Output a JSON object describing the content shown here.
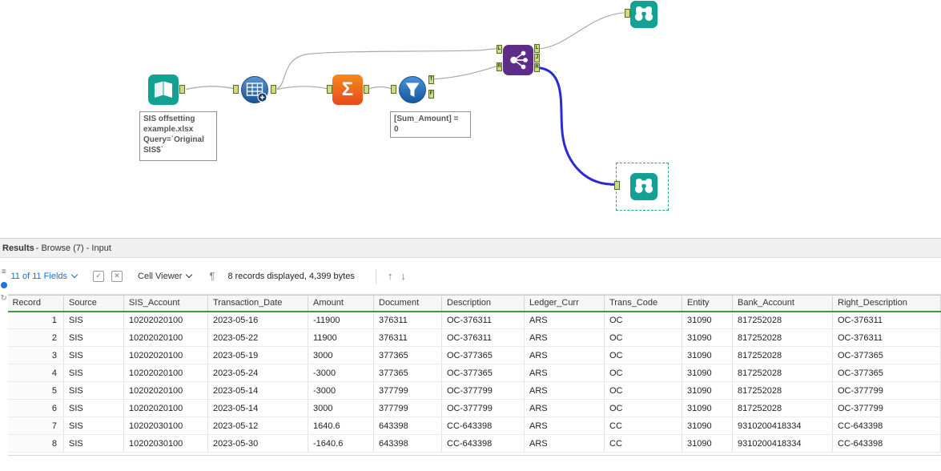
{
  "workflow": {
    "annotations": {
      "input": "SIS offsetting\nexample.xlsx\nQuery=`Original\nSIS$`",
      "filter": "[Sum_Amount] =\n0"
    },
    "summarize_glyph": "Σ",
    "anchors": {
      "filter_true": "T",
      "filter_false": "F",
      "join_in_left": "L",
      "join_in_right": "R",
      "join_out_left": "L",
      "join_out_join": "J",
      "join_out_right": "R"
    }
  },
  "results": {
    "header": {
      "title": "Results",
      "subtitle": " - Browse (7) - Input"
    },
    "toolbar": {
      "fields_label": "11 of 11 Fields",
      "check_glyph": "✓",
      "x_glyph": "✕",
      "cell_viewer_label": "Cell Viewer",
      "pilcrow": "¶",
      "records_info": "8 records displayed, 4,399 bytes",
      "up_arrow": "↑",
      "down_arrow": "↓"
    },
    "table": {
      "columns": [
        "Record",
        "Source",
        "SIS_Account",
        "Transaction_Date",
        "Amount",
        "Document",
        "Description",
        "Ledger_Curr",
        "Trans_Code",
        "Entity",
        "Bank_Account",
        "Right_Description"
      ],
      "rows": [
        [
          "1",
          "SIS",
          "10202020100",
          "2023-05-16",
          "-11900",
          "376311",
          "OC-376311",
          "ARS",
          "OC",
          "31090",
          "817252028",
          "OC-376311"
        ],
        [
          "2",
          "SIS",
          "10202020100",
          "2023-05-22",
          "11900",
          "376311",
          "OC-376311",
          "ARS",
          "OC",
          "31090",
          "817252028",
          "OC-376311"
        ],
        [
          "3",
          "SIS",
          "10202020100",
          "2023-05-19",
          "3000",
          "377365",
          "OC-377365",
          "ARS",
          "OC",
          "31090",
          "817252028",
          "OC-377365"
        ],
        [
          "4",
          "SIS",
          "10202020100",
          "2023-05-24",
          "-3000",
          "377365",
          "OC-377365",
          "ARS",
          "OC",
          "31090",
          "817252028",
          "OC-377365"
        ],
        [
          "5",
          "SIS",
          "10202020100",
          "2023-05-14",
          "-3000",
          "377799",
          "OC-377799",
          "ARS",
          "OC",
          "31090",
          "817252028",
          "OC-377799"
        ],
        [
          "6",
          "SIS",
          "10202020100",
          "2023-05-14",
          "3000",
          "377799",
          "OC-377799",
          "ARS",
          "OC",
          "31090",
          "817252028",
          "OC-377799"
        ],
        [
          "7",
          "SIS",
          "10202030100",
          "2023-05-12",
          "1640.6",
          "643398",
          "CC-643398",
          "ARS",
          "CC",
          "31090",
          "9310200418334",
          "CC-643398"
        ],
        [
          "8",
          "SIS",
          "10202030100",
          "2023-05-30",
          "-1640.6",
          "643398",
          "CC-643398",
          "ARS",
          "CC",
          "31090",
          "9310200418334",
          "CC-643398"
        ]
      ]
    }
  },
  "colors": {
    "teal": "#12a193",
    "join_purple": "#5d2d87",
    "summarize_orange": "#ee5a24",
    "filter_blue": "#1d6ec2",
    "wire_blue": "#2b2bd4",
    "grid_green": "#3a9c3a",
    "link_blue": "#1673c7"
  }
}
